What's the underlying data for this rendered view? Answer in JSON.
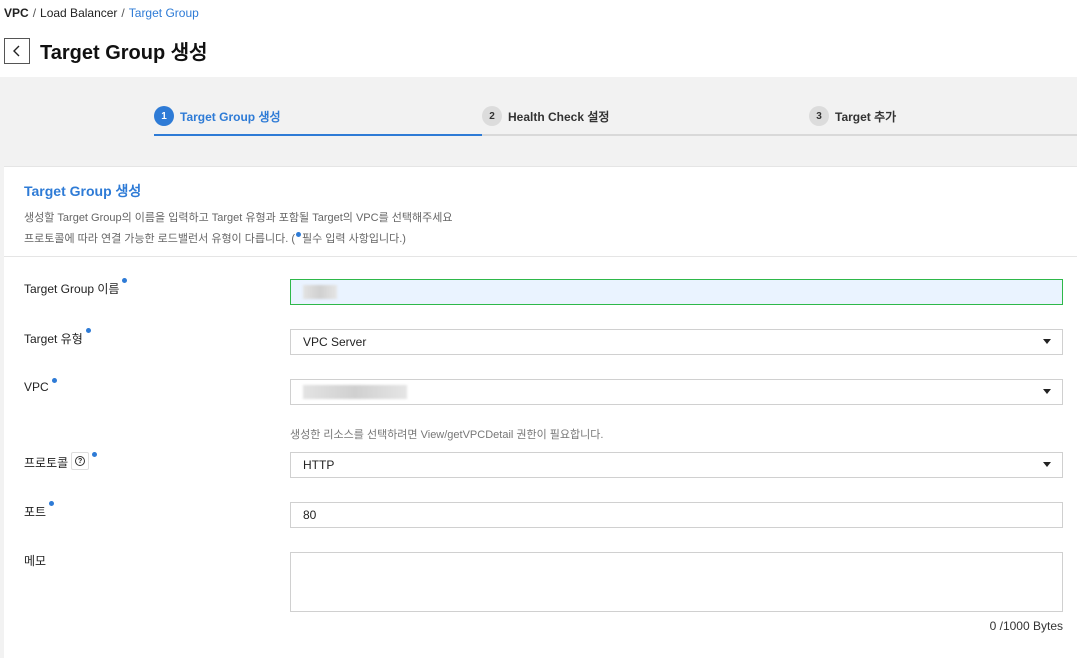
{
  "breadcrumb": {
    "root": "VPC",
    "sep": "/",
    "middle": "Load Balancer",
    "current": "Target Group"
  },
  "header": {
    "title": "Target Group 생성",
    "back_icon": "chevron-left-icon"
  },
  "steps": [
    {
      "num": "1",
      "label": "Target Group 생성",
      "active": true
    },
    {
      "num": "2",
      "label": "Health Check 설정",
      "active": false
    },
    {
      "num": "3",
      "label": "Target 추가",
      "active": false
    }
  ],
  "section": {
    "title": "Target Group 생성",
    "desc_line1": "생성할 Target Group의 이름을 입력하고 Target 유형과 포함될 Target의 VPC를 선택해주세요",
    "desc_line2_pre": "프로토콜에 따라 연결 가능한 로드밸런서 유형이 다릅니다. (",
    "desc_line2_post": "필수 입력 사항입니다.)"
  },
  "form": {
    "name": {
      "label": "Target Group 이름",
      "value": ""
    },
    "target_type": {
      "label": "Target 유형",
      "value": "VPC Server"
    },
    "vpc": {
      "label": "VPC",
      "value": "",
      "hint": "생성한 리소스를 선택하려면 View/getVPCDetail 권한이 필요합니다."
    },
    "protocol": {
      "label": "프로토콜",
      "value": "HTTP",
      "help_icon": "question-circle-icon"
    },
    "port": {
      "label": "포트",
      "value": "80"
    },
    "memo": {
      "label": "메모",
      "value": "",
      "byte_count": "0 /1000 Bytes"
    }
  },
  "colors": {
    "accent": "#2e7bd6",
    "active_border": "#2eb84a"
  }
}
